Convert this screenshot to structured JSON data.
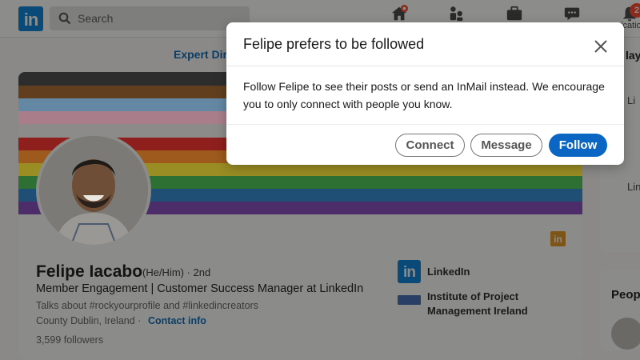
{
  "navbar": {
    "logo_text": "in",
    "search_placeholder": "Search",
    "notifications_badge": "2",
    "notifications_label": "ication"
  },
  "banner_link": "Expert Dir",
  "colors": {
    "brand": "#0a66c2",
    "pride_stripes": [
      "#2d2d2d",
      "#603e1e",
      "#6487a3",
      "#a97e8a",
      "#8c8b89",
      "#8e1f1c",
      "#9d5a1c",
      "#9a8d24",
      "#2e6f33",
      "#1f4f74",
      "#4d2c6a"
    ]
  },
  "profile": {
    "name": "Felipe Iacabo",
    "pronouns_degree": "(He/Him) · 2nd",
    "headline": "Member Engagement | Customer Success Manager at LinkedIn",
    "talks_about": "Talks about #rockyourprofile and #linkedincreators",
    "location": "County Dublin, Ireland ·",
    "contact_info": "Contact info",
    "followers": "3,599 followers",
    "company": "LinkedIn",
    "company_logo_text": "in",
    "education_line1": "Institute of Project",
    "education_line2": "Management Ireland",
    "banner_badge": "in"
  },
  "sidebar": {
    "card1_title": "lay.",
    "card1_line1": "Li",
    "card1_line2": "Lin",
    "card2_title": "Peop"
  },
  "modal": {
    "title": "Felipe prefers to be followed",
    "body": "Follow Felipe to see their posts or send an InMail instead. We encourage you to only connect with people you know.",
    "connect_label": "Connect",
    "message_label": "Message",
    "follow_label": "Follow"
  }
}
